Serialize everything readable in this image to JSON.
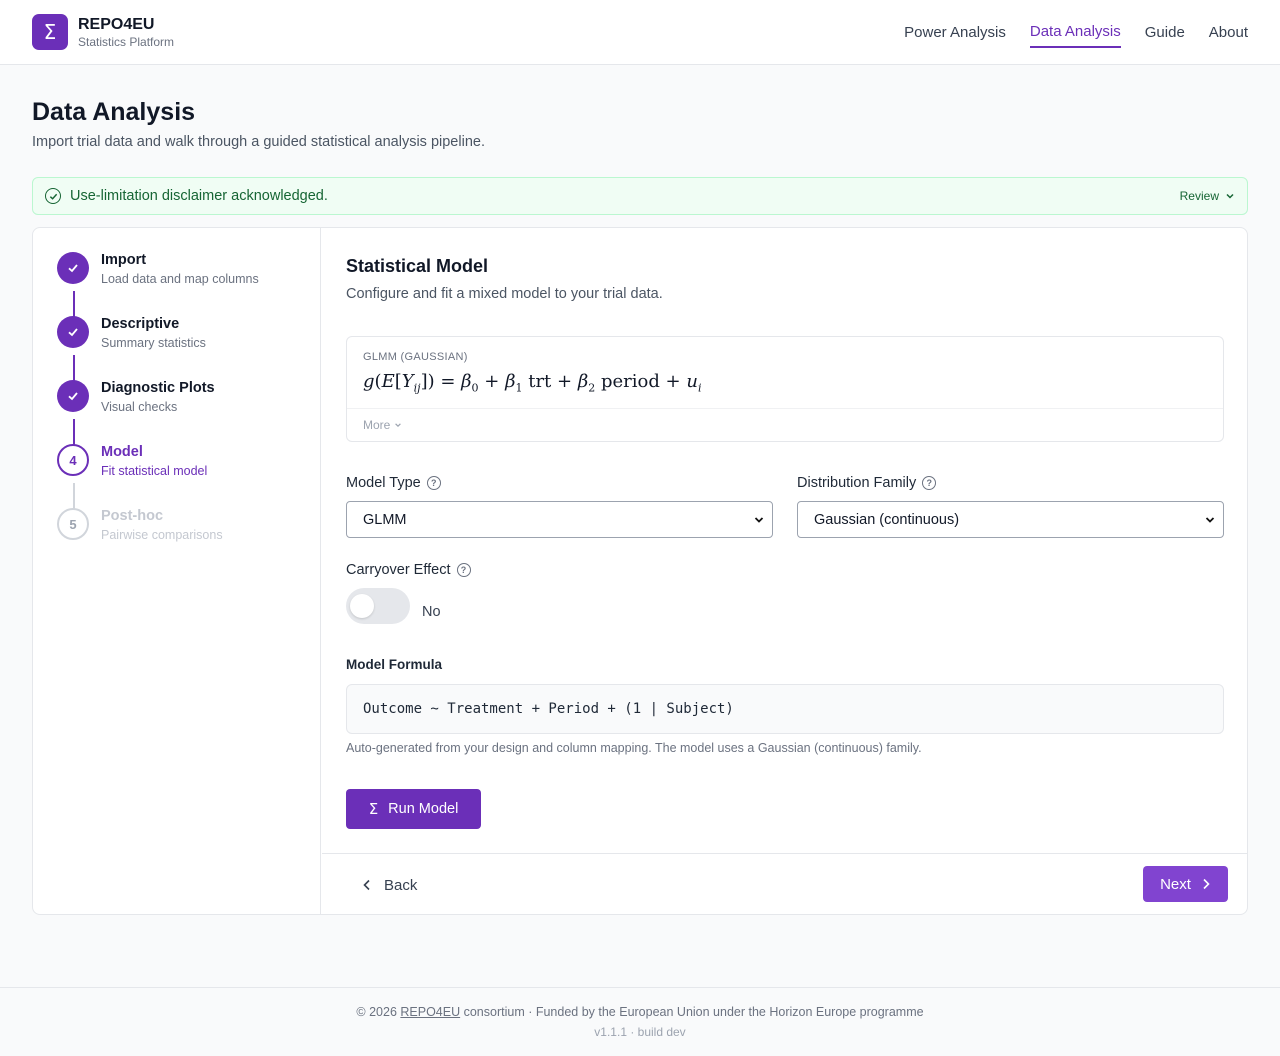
{
  "app": {
    "name": "REPO4EU",
    "subtitle": "Statistics Platform",
    "logo_symbol": "Σ",
    "accent": "#6b2fb8"
  },
  "nav": [
    {
      "label": "Power Analysis",
      "active": false
    },
    {
      "label": "Data Analysis",
      "active": true
    },
    {
      "label": "Guide",
      "active": false
    },
    {
      "label": "About",
      "active": false
    }
  ],
  "page": {
    "title": "Data Analysis",
    "subtitle": "Import trial data and walk through a guided statistical analysis pipeline."
  },
  "notice": {
    "text": "Use-limitation disclaimer acknowledged.",
    "action": "Review"
  },
  "steps": [
    {
      "number": "1",
      "title": "Import",
      "desc": "Load data and map columns",
      "status": "done"
    },
    {
      "number": "2",
      "title": "Descriptive",
      "desc": "Summary statistics",
      "status": "done"
    },
    {
      "number": "3",
      "title": "Diagnostic Plots",
      "desc": "Visual checks",
      "status": "done"
    },
    {
      "number": "4",
      "title": "Model",
      "desc": "Fit statistical model",
      "status": "current"
    },
    {
      "number": "5",
      "title": "Post-hoc",
      "desc": "Pairwise comparisons",
      "status": "future"
    }
  ],
  "section": {
    "title": "Statistical Model",
    "subtitle": "Configure and fit a mixed model to your trial data."
  },
  "formula_card": {
    "label": "GLMM (GAUSSIAN)",
    "more": "More"
  },
  "model_type": {
    "label": "Model Type",
    "value": "GLMM"
  },
  "distribution": {
    "label": "Distribution Family",
    "value": "Gaussian (continuous)"
  },
  "carryover": {
    "label": "Carryover Effect",
    "state": "No",
    "on": false
  },
  "model_formula": {
    "label": "Model Formula",
    "value": "Outcome ~ Treatment + Period + (1 | Subject)",
    "hint": "Auto-generated from your design and column mapping. The model uses a Gaussian (continuous) family."
  },
  "buttons": {
    "run": "Run Model",
    "back": "Back",
    "next": "Next"
  },
  "footer": {
    "prefix": "© 2026 ",
    "link": "REPO4EU",
    "suffix": " consortium · Funded by the European Union under the Horizon Europe programme",
    "version": "v1.1.1 · build dev"
  }
}
